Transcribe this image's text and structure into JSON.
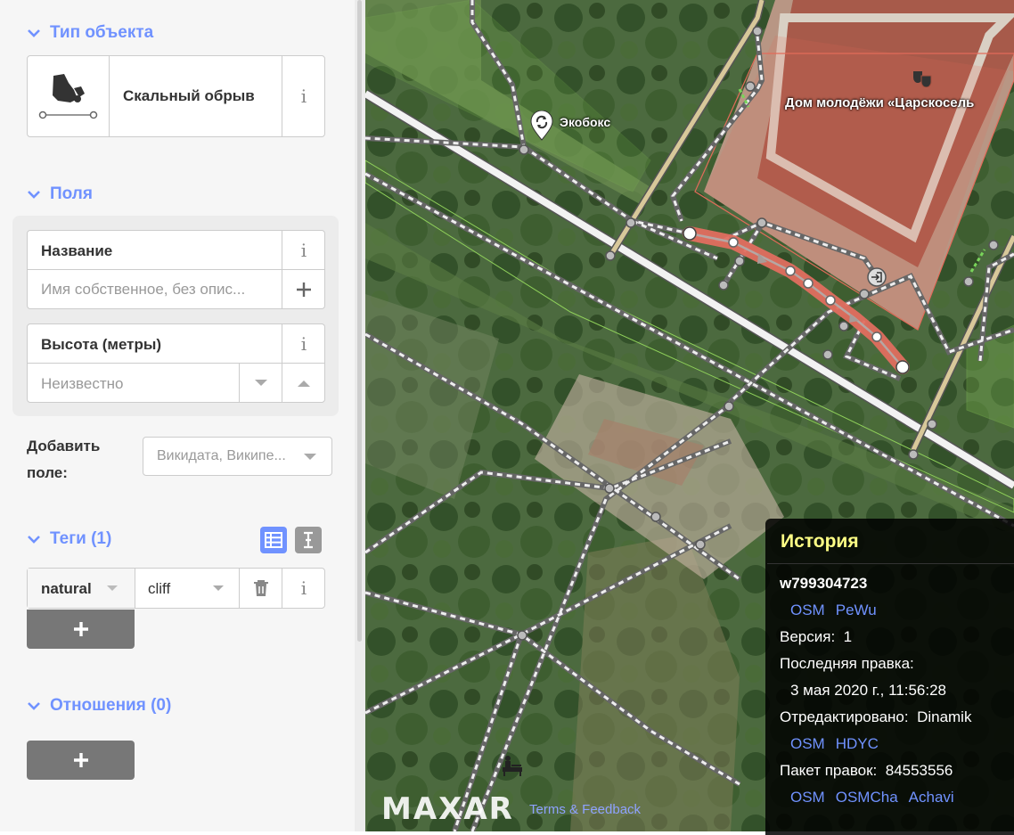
{
  "sidebar": {
    "preset_section": {
      "title": "Тип объекта",
      "preset_name": "Скальный обрыв",
      "icon": "cliff-icon"
    },
    "fields_section": {
      "title": "Поля",
      "name_field": {
        "label": "Название",
        "placeholder": "Имя собственное, без опис..."
      },
      "height_field": {
        "label": "Высота (метры)",
        "placeholder": "Неизвестно"
      }
    },
    "add_field": {
      "label_line1": "Добавить",
      "label_line2": "поле:",
      "placeholder": "Викидата, Википе..."
    },
    "tags_section": {
      "title": "Теги (1)",
      "tags": [
        {
          "key": "natural",
          "value": "cliff"
        }
      ]
    },
    "relations_section": {
      "title": "Отношения (0)"
    },
    "info_symbol": "i",
    "plus_symbol": "+"
  },
  "map": {
    "labels": {
      "ecobox": "Экобокс",
      "building": "Дом молодёжи «Царскосель"
    },
    "attribution": {
      "logo": "MAXAR",
      "terms": "Terms & Feedback"
    }
  },
  "history": {
    "title": "История",
    "way_id": "w799304723",
    "way_links": [
      "OSM",
      "PeWu"
    ],
    "version_label": "Версия:",
    "version": "1",
    "last_edit_label": "Последняя правка:",
    "last_edit": "3 мая 2020 г., 11:56:28",
    "edited_by_label": "Отредактировано:",
    "edited_by": "Dinamik",
    "user_links": [
      "OSM",
      "HDYC"
    ],
    "changeset_label": "Пакет правок:",
    "changeset": "84553556",
    "changeset_links": [
      "OSM",
      "OSMCha",
      "Achavi"
    ]
  },
  "colors": {
    "accent": "#7092ff",
    "selected_way": "#e06e5f",
    "history_title": "#ffff85"
  }
}
